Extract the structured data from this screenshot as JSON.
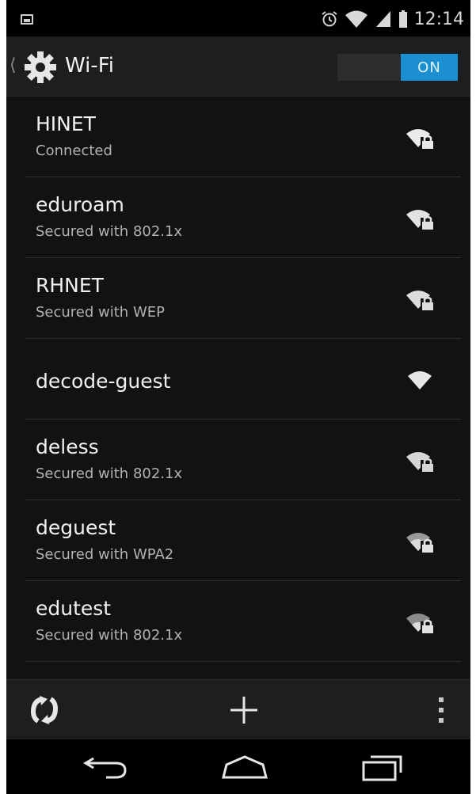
{
  "status_bar": {
    "time": "12:14",
    "icons": [
      "screenshot-notification-icon",
      "alarm-icon",
      "wifi-signal-icon",
      "cell-signal-icon",
      "battery-icon"
    ]
  },
  "action_bar": {
    "title": "Wi-Fi",
    "toggle_label": "ON",
    "icons": [
      "back-caret-icon",
      "settings-gear-icon"
    ]
  },
  "networks": [
    {
      "name": "HINET",
      "status": "Connected",
      "secured": true
    },
    {
      "name": "eduroam",
      "status": "Secured with 802.1x",
      "secured": true
    },
    {
      "name": "RHNET",
      "status": "Secured with WEP",
      "secured": true
    },
    {
      "name": "decode-guest",
      "status": "",
      "secured": false
    },
    {
      "name": "deless",
      "status": "Secured with 802.1x",
      "secured": true
    },
    {
      "name": "deguest",
      "status": "Secured with WPA2",
      "secured": true
    },
    {
      "name": "edutest",
      "status": "Secured with 802.1x",
      "secured": true
    }
  ],
  "bottom_actions": {
    "icons": [
      "wps-refresh-icon",
      "add-network-icon",
      "overflow-menu-icon"
    ]
  },
  "nav_bar": {
    "icons": [
      "back-icon",
      "home-icon",
      "recent-apps-icon"
    ]
  },
  "colors": {
    "accent": "#1b8fcf",
    "background": "#111214",
    "action_bar": "#1d1e20"
  }
}
